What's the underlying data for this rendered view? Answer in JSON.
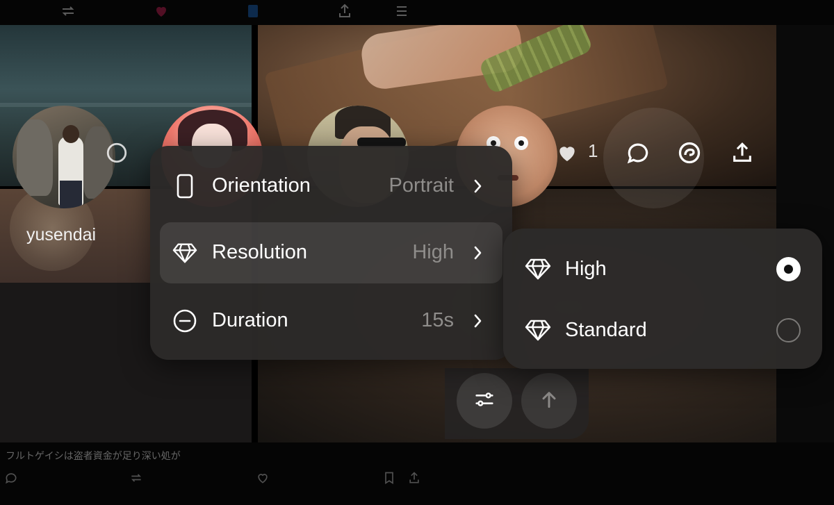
{
  "feed": {
    "username": "yusendai",
    "like_count": "1",
    "caption_fragment": "フルトゲイシは盗者資金が足り深い処が"
  },
  "settings_menu": {
    "items": [
      {
        "label": "Orientation",
        "value": "Portrait",
        "icon": "phone-portrait-icon"
      },
      {
        "label": "Resolution",
        "value": "High",
        "icon": "diamond-icon",
        "active": true
      },
      {
        "label": "Duration",
        "value": "15s",
        "icon": "timer-icon"
      }
    ]
  },
  "resolution_menu": {
    "options": [
      {
        "label": "High",
        "icon": "diamond-icon",
        "selected": true
      },
      {
        "label": "Standard",
        "icon": "diamond-icon",
        "selected": false
      }
    ]
  },
  "composer": {
    "settings_icon": "sliders-icon",
    "send_icon": "arrow-up-icon"
  },
  "colors": {
    "menu_bg": "#2c2a29",
    "active_row": "#3f3d3c",
    "secondary_text": "#8f8d8b",
    "text": "#ffffff"
  }
}
